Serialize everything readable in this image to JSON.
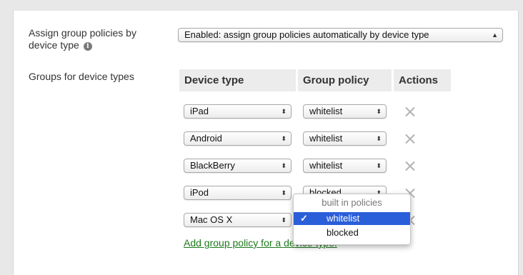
{
  "assign": {
    "label_line1": "Assign group policies by",
    "label_line2": "device type",
    "info_icon": "info-icon",
    "value": "Enabled: assign group policies automatically by device type"
  },
  "groups": {
    "label": "Groups for device types",
    "headers": {
      "device_type": "Device type",
      "group_policy": "Group policy",
      "actions": "Actions"
    },
    "rows": [
      {
        "device": "iPad",
        "policy": "whitelist"
      },
      {
        "device": "Android",
        "policy": "whitelist"
      },
      {
        "device": "BlackBerry",
        "policy": "whitelist"
      },
      {
        "device": "iPod",
        "policy": "blocked"
      },
      {
        "device": "Mac OS X",
        "policy": ""
      }
    ],
    "add_link": "Add group policy for a device type."
  },
  "dropdown": {
    "group_label": "built in policies",
    "items": [
      {
        "label": "whitelist",
        "selected": true
      },
      {
        "label": "blocked",
        "selected": false
      }
    ],
    "check": "✓"
  },
  "colors": {
    "link": "#1d7a1d",
    "selection": "#2b5fd9"
  }
}
